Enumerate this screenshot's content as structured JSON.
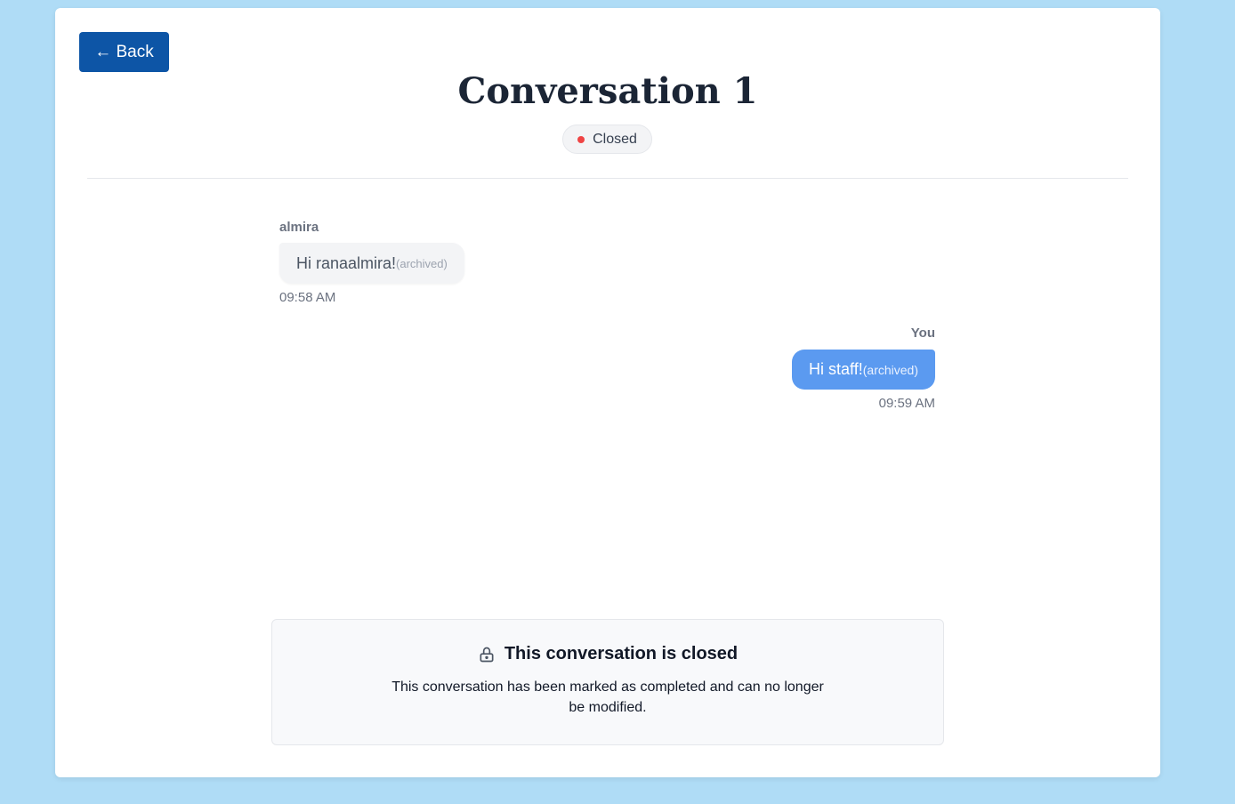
{
  "header": {
    "back_label": "← Back",
    "title": "Conversation 1",
    "status": "Closed",
    "status_color": "#ef4444"
  },
  "messages": [
    {
      "sender": "almira",
      "text": "Hi ranaalmira!",
      "tag": "(archived)",
      "time": "09:58 AM",
      "direction": "incoming"
    },
    {
      "sender": "You",
      "text": "Hi staff!",
      "tag": "(archived)",
      "time": "09:59 AM",
      "direction": "outgoing"
    }
  ],
  "closed_notice": {
    "icon": "lock-icon",
    "title": "This conversation is closed",
    "description": "This conversation has been marked as completed and can no longer be modified."
  },
  "colors": {
    "background": "#afdcf6",
    "back_button": "#0d55a6",
    "outgoing_bubble": "#5b9af0",
    "incoming_bubble": "#f3f4f6"
  }
}
